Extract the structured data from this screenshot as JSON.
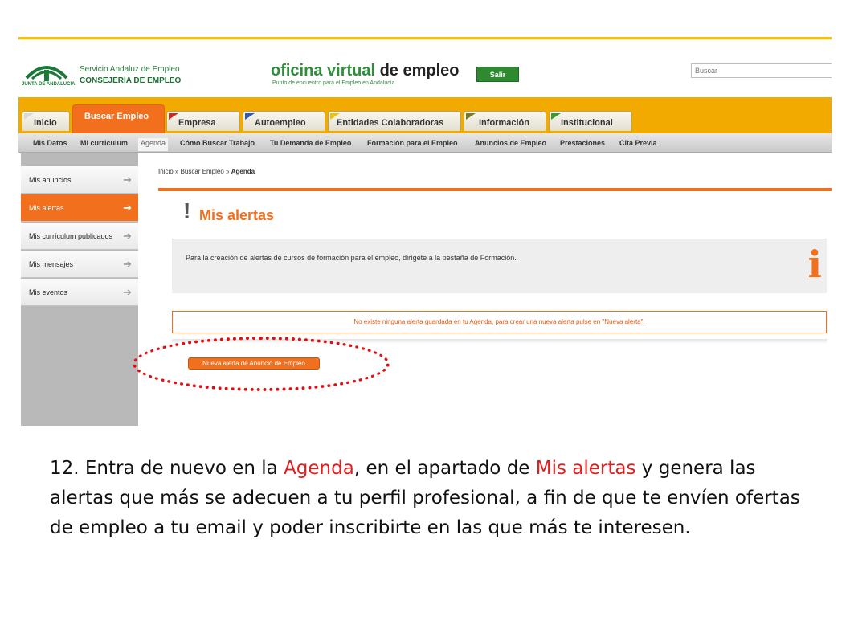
{
  "header": {
    "org_line1": "Servicio Andaluz de Empleo",
    "org_line2": "CONSEJERÍA DE EMPLEO",
    "logo_sub": "JUNTA DE ANDALUCIA",
    "site_title_green": "oficina virtual",
    "site_title_dark": "de empleo",
    "site_subtitle": "Punto de encuentro para el Empleo en Andalucía",
    "salir_label": "Salir",
    "search_placeholder": "Buscar"
  },
  "tabs": [
    {
      "label": "Inicio",
      "flag_color": "#d9d9d9"
    },
    {
      "label": "Buscar Empleo",
      "flag_color": "#f26f1e",
      "active": true
    },
    {
      "label": "Empresa",
      "flag_color": "#d02a20"
    },
    {
      "label": "Autoempleo",
      "flag_color": "#2a58c8"
    },
    {
      "label": "Entidades Colaboradoras",
      "flag_color": "#f2c200"
    },
    {
      "label": "Información",
      "flag_color": "#7a7a2a"
    },
    {
      "label": "Institucional",
      "flag_color": "#3a9a2a"
    }
  ],
  "subnav": [
    "Mis Datos",
    "Mi curriculum",
    "Agenda",
    "Cómo Buscar Trabajo",
    "Tu Demanda de Empleo",
    "Formación para el Empleo",
    "Anuncios de Empleo",
    "Prestaciones",
    "Cita Previa"
  ],
  "sidebar": [
    {
      "label": "Mis anuncios"
    },
    {
      "label": "Mis alertas",
      "active": true
    },
    {
      "label": "Mis currículum publicados"
    },
    {
      "label": "Mis mensajes"
    },
    {
      "label": "Mis eventos"
    }
  ],
  "breadcrumb": {
    "prefix": "Inicio » Buscar Empleo » ",
    "current": "Agenda"
  },
  "main": {
    "title": "Mis alertas",
    "info_text": "Para la creación de alertas de cursos de formación para el empleo, dirígete a la pestaña de Formación.",
    "alert_text": "No existe ninguna alerta guardada en tu Agenda, para crear una nueva alerta pulse en \"Nueva alerta\".",
    "new_alert_button": "Nueva alerta de Anuncio de Empleo"
  },
  "caption": {
    "part1": "12. Entra de nuevo en la ",
    "highlight1": "Agenda",
    "part2": ", en el apartado de ",
    "highlight2": "Mis alertas",
    "part3": " y genera las alertas que más se adecuen a tu perfil profesional, a fin de que te envíen ofertas de empleo a tu email y poder inscribirte en las que más te interesen."
  },
  "colors": {
    "accent_orange": "#f26f1e",
    "tab_bar_yellow": "#f2a900",
    "highlight_red": "#e02020"
  }
}
